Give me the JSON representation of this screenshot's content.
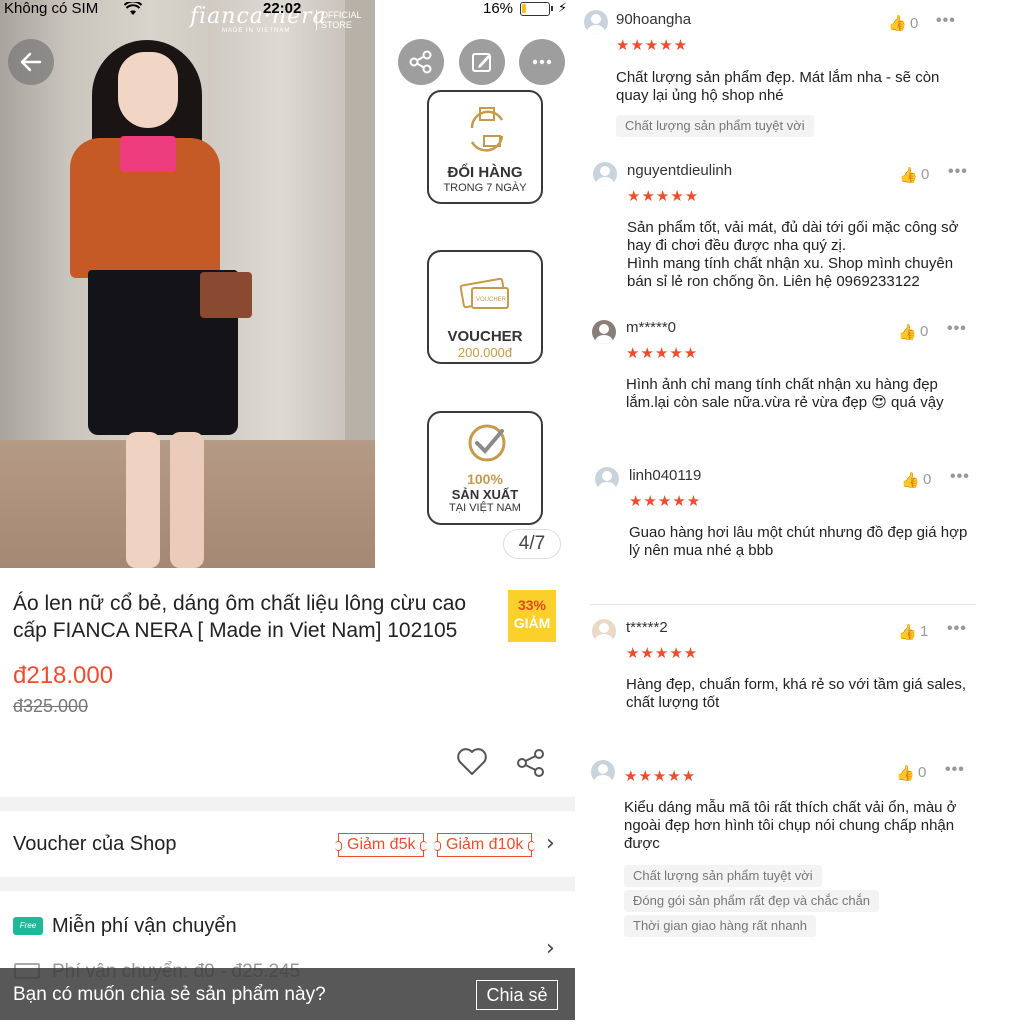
{
  "status": {
    "carrier": "Không có SIM",
    "time": "22:02",
    "battery_pct": "16%",
    "battery_level": 0.16
  },
  "brand": {
    "name": "fianca·nera",
    "made_in": "MADE IN VIETNAM",
    "official": "OFFICIAL STORE"
  },
  "badges": [
    {
      "line1": "ĐỔI HÀNG",
      "line2": "TRONG 7 NGÀY",
      "icon": "return-box-icon"
    },
    {
      "line1": "VOUCHER",
      "line2": "200.000đ",
      "icon": "voucher-ticket-icon"
    },
    {
      "line1": "100%",
      "line2": "SẢN XUẤT",
      "line3": "TẠI VIỆT NAM",
      "icon": "check-badge-icon"
    }
  ],
  "gallery": {
    "indicator": "4/7"
  },
  "product": {
    "title": "Áo len nữ cổ bẻ, dáng ôm chất liệu lông cừu cao cấp FIANCA NERA [ Made in Viet Nam] 102105",
    "discount_pct": "33%",
    "discount_label": "GIẢM",
    "price": "đ218.000",
    "old_price": "đ325.000"
  },
  "voucher": {
    "label": "Voucher của Shop",
    "tags": [
      "Giảm đ5k",
      "Giảm đ10k"
    ]
  },
  "shipping": {
    "label": "Miễn phí vận chuyển",
    "fee": "Phí vận chuyển: đ0 - đ25.245",
    "free_badge": "Free"
  },
  "share_prompt": {
    "question": "Bạn có muốn chia sẻ sản phẩm này?",
    "button": "Chia sẻ"
  },
  "reviews": [
    {
      "user": "90hoangha",
      "likes": "0",
      "stars": "★★★★★",
      "text": [
        "Chất lượng sản phẩm đẹp. Mát lắm nha - sẽ còn",
        "quay lại ủng hộ shop nhé"
      ],
      "tags": [
        "Chất lượng sản phẩm tuyệt vời"
      ]
    },
    {
      "user": "nguyentdieulinh",
      "likes": "0",
      "stars": "★★★★★",
      "text": [
        "Sản phẩm tốt, vải mát, đủ dài tới gối mặc công sở",
        "hay đi chơi đều được nha quý zị.",
        "Hình mang tính chất nhận xu. Shop mình chuyên",
        "bán sỉ lẻ ron chống ồn. Liên hệ 0969233122"
      ],
      "tags": []
    },
    {
      "user": "m*****0",
      "likes": "0",
      "stars": "★★★★★",
      "text": [
        "Hình ảnh chỉ mang tính chất nhận xu hàng đẹp",
        "lắm.lại còn sale nữa.vừa rẻ vừa đẹp 😍 quá vậy"
      ],
      "tags": []
    },
    {
      "user": "linh040119",
      "likes": "0",
      "stars": "★★★★★",
      "text": [
        "Guao hàng hơi lâu một chút nhưng đồ đẹp giá hợp",
        "lý nên mua nhé ạ bbb"
      ],
      "tags": []
    },
    {
      "user": "t*****2",
      "likes": "1",
      "stars": "★★★★★",
      "text": [
        "Hàng đẹp, chuẩn form, khá rẻ so với tầm giá sales,",
        "chất lượng tốt"
      ],
      "tags": []
    },
    {
      "user": "",
      "likes": "0",
      "stars": "★★★★★",
      "text": [
        "Kiểu dáng mẫu mã tôi rất thích chất vải ổn, màu ở",
        "ngoài đẹp hơn hình tôi chụp nói chung chấp nhận",
        "được"
      ],
      "tags": [
        "Chất lượng sản phẩm tuyệt vời",
        "Đóng gói sản phẩm rất đẹp và chắc chắn",
        "Thời gian giao hàng rất nhanh"
      ]
    }
  ],
  "colors": {
    "accent": "#ee4d2d",
    "discount_bg": "#fbd02a",
    "free_ship": "#21b89a",
    "star": "#ee4d2d"
  }
}
